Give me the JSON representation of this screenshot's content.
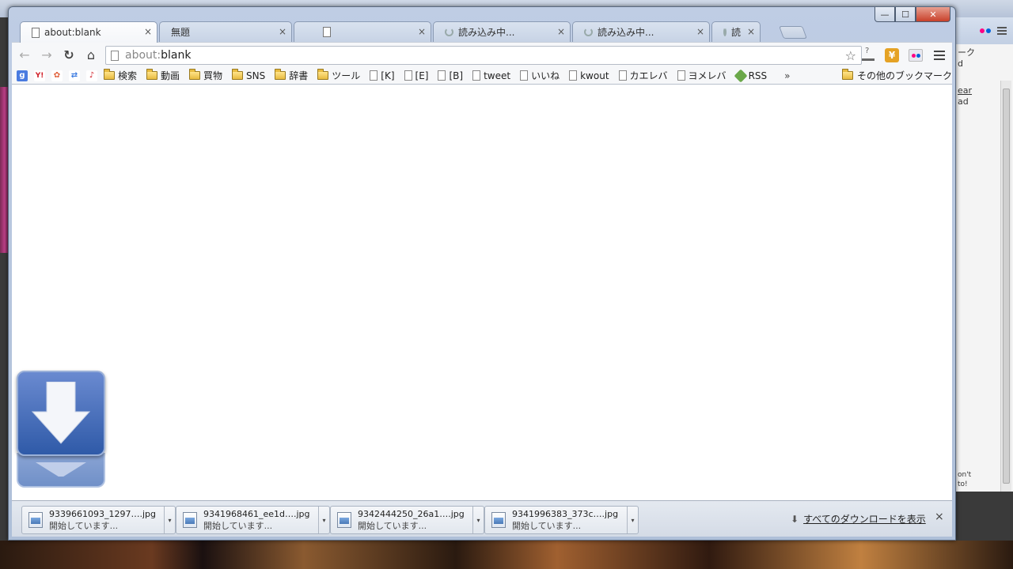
{
  "window": {
    "controls": {
      "minimize": "—",
      "maximize": "☐",
      "close": "✕"
    }
  },
  "tabs": [
    {
      "label": "about:blank",
      "active": true,
      "icon": "page-icon"
    },
    {
      "label": "無題",
      "active": false,
      "icon": "none"
    },
    {
      "label": "",
      "active": false,
      "icon": "page-icon"
    },
    {
      "label": "読み込み中...",
      "active": false,
      "icon": "spinner"
    },
    {
      "label": "読み込み中...",
      "active": false,
      "icon": "spinner"
    },
    {
      "label": "読",
      "active": false,
      "icon": "spinner"
    }
  ],
  "toolbar": {
    "back": "←",
    "forward": "→",
    "reload": "↻",
    "home": "⌂",
    "url_scheme": "about:",
    "url_host": "blank",
    "star": "☆",
    "menu": "menu-icon"
  },
  "bookmarks": [
    {
      "label": "",
      "icon": "google-icon",
      "color": "#4a7be0",
      "glyph": "g"
    },
    {
      "label": "",
      "icon": "yahoo-icon",
      "color": "#d0202a",
      "glyph": "Y!"
    },
    {
      "label": "",
      "icon": "hatena-icon",
      "color": "#e0603a",
      "glyph": "✿"
    },
    {
      "label": "",
      "icon": "sync-icon",
      "color": "#3a7ae0",
      "glyph": "⇄"
    },
    {
      "label": "",
      "icon": "music-icon",
      "color": "#d0202a",
      "glyph": "♪"
    },
    {
      "label": "検索",
      "icon": "folder-icon"
    },
    {
      "label": "動画",
      "icon": "folder-icon"
    },
    {
      "label": "買物",
      "icon": "folder-icon"
    },
    {
      "label": "SNS",
      "icon": "folder-icon"
    },
    {
      "label": "辞書",
      "icon": "folder-icon"
    },
    {
      "label": "ツール",
      "icon": "folder-icon"
    },
    {
      "label": "[K]",
      "icon": "page-icon"
    },
    {
      "label": "[E]",
      "icon": "page-icon"
    },
    {
      "label": "[B]",
      "icon": "page-icon"
    },
    {
      "label": "tweet",
      "icon": "page-icon"
    },
    {
      "label": "いいね",
      "icon": "page-icon"
    },
    {
      "label": "kwout",
      "icon": "page-icon"
    },
    {
      "label": "カエレバ",
      "icon": "page-icon"
    },
    {
      "label": "ヨメレバ",
      "icon": "page-icon"
    },
    {
      "label": "RSS",
      "icon": "rss-icon"
    }
  ],
  "bookmarks_more": "»",
  "bookmarks_other": "その他のブックマーク",
  "downloads": [
    {
      "filename": "9339661093_1297….jpg",
      "status": "開始しています..."
    },
    {
      "filename": "9341968461_ee1d….jpg",
      "status": "開始しています..."
    },
    {
      "filename": "9342444250_26a1….jpg",
      "status": "開始しています..."
    },
    {
      "filename": "9341996383_373c….jpg",
      "status": "開始しています..."
    }
  ],
  "downloads_show_all": "すべてのダウンロードを表示",
  "downloads_close": "×",
  "background_window": {
    "text_lines": [
      "d",
      "ear",
      "ad"
    ],
    "text_bottom": [
      "on't",
      "to!"
    ],
    "snippet_top": "ーク"
  },
  "colors": {
    "flickr_pink": "#ff0084",
    "flickr_blue": "#0063dc",
    "download_blue": "#2f5aa8"
  }
}
